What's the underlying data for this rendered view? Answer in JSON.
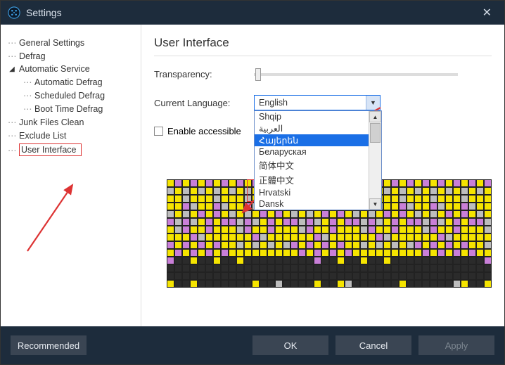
{
  "window": {
    "title": "Settings"
  },
  "sidebar": {
    "items": [
      {
        "label": "General Settings"
      },
      {
        "label": "Defrag"
      },
      {
        "label": "Automatic Service",
        "expanded": true,
        "children": [
          {
            "label": "Automatic Defrag"
          },
          {
            "label": "Scheduled Defrag"
          },
          {
            "label": "Boot Time Defrag"
          }
        ]
      },
      {
        "label": "Junk Files Clean"
      },
      {
        "label": "Exclude List"
      },
      {
        "label": "User Interface",
        "selected": true
      }
    ]
  },
  "main": {
    "heading": "User Interface",
    "transparency_label": "Transparency:",
    "language_label": "Current Language:",
    "language_value": "English",
    "language_options": [
      "Shqip",
      "العربية",
      "Հայերեն",
      "Беларуская",
      "简体中文",
      "正體中文",
      "Hrvatski",
      "Dansk"
    ],
    "language_selected_index": 2,
    "accessible_label": "Enable accessible ",
    "accessible_checked": false
  },
  "footer": {
    "recommended": "Recommended",
    "ok": "OK",
    "cancel": "Cancel",
    "apply": "Apply"
  },
  "annotations": {
    "highlight_options": [
      "简体中文",
      "正體中文"
    ]
  }
}
